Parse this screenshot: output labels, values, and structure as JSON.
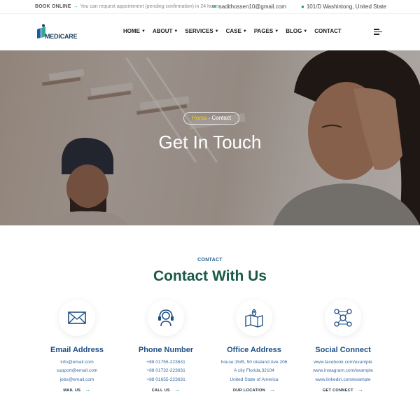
{
  "topbar": {
    "book_online": "BOOK ONLINE",
    "notice": "You can request appointment (pending confirmation) in 24 hours",
    "email": "sadithossen10@gmail.com",
    "address": "101/D Washintong, United State"
  },
  "header": {
    "logo_text": "MEDICARE",
    "nav": [
      {
        "label": "HOME",
        "dropdown": true
      },
      {
        "label": "ABOUT",
        "dropdown": true
      },
      {
        "label": "SERVICES",
        "dropdown": true
      },
      {
        "label": "CASE",
        "dropdown": true
      },
      {
        "label": "PAGES",
        "dropdown": true
      },
      {
        "label": "BLOG",
        "dropdown": true
      },
      {
        "label": "CONTACT",
        "dropdown": false
      }
    ]
  },
  "hero": {
    "breadcrumb_home": "Home",
    "breadcrumb_current": "- Contact",
    "title": "Get In Touch"
  },
  "contact": {
    "kicker": "CONTACT",
    "title": "Contact With Us",
    "cards": [
      {
        "icon": "envelope-icon",
        "title": "Email Address",
        "lines": [
          "info@email.com",
          "support@email.com",
          "jobs@email.com"
        ],
        "cta": "MAIL US"
      },
      {
        "icon": "headset-icon",
        "title": "Phone Number",
        "lines": [
          "+88 01755-223631",
          "+88 01732-223631",
          "+88 01655-223631"
        ],
        "cta": "CALL US"
      },
      {
        "icon": "map-pin-icon",
        "title": "Office Address",
        "lines": [
          "house:15/B, 50 okaland Ave 206",
          "A city Florida,32104",
          "United State of America"
        ],
        "cta": "OUR LOCATION"
      },
      {
        "icon": "network-icon",
        "title": "Social Connect",
        "lines": [
          "www.facebook.com/example",
          "www.instagram.com/example",
          "www.linkedin.com/example"
        ],
        "cta": "GET CONNECT"
      }
    ]
  },
  "colors": {
    "brand_navy": "#1f4f86",
    "brand_green": "#1a5947",
    "teal": "#1f8f86",
    "breadcrumb_home": "#f2d11f"
  }
}
